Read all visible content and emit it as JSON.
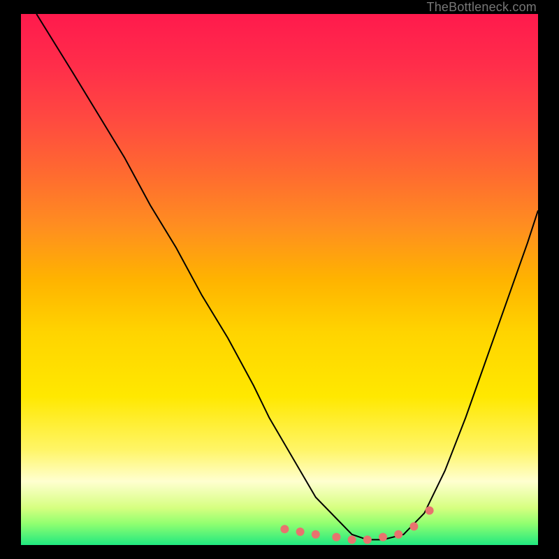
{
  "watermark": {
    "text": "TheBottleneck.com"
  },
  "gradient": {
    "stops": [
      {
        "offset": 0.0,
        "color": "#ff1a4d"
      },
      {
        "offset": 0.1,
        "color": "#ff2e4a"
      },
      {
        "offset": 0.2,
        "color": "#ff4a40"
      },
      {
        "offset": 0.3,
        "color": "#ff6a30"
      },
      {
        "offset": 0.4,
        "color": "#ff8e20"
      },
      {
        "offset": 0.5,
        "color": "#ffb300"
      },
      {
        "offset": 0.6,
        "color": "#ffd400"
      },
      {
        "offset": 0.72,
        "color": "#ffe800"
      },
      {
        "offset": 0.82,
        "color": "#fff566"
      },
      {
        "offset": 0.88,
        "color": "#ffffd0"
      },
      {
        "offset": 0.93,
        "color": "#d6ff80"
      },
      {
        "offset": 0.96,
        "color": "#90ff70"
      },
      {
        "offset": 1.0,
        "color": "#20e880"
      }
    ]
  },
  "marker": {
    "color": "#e8736e",
    "radius_px": 6
  },
  "chart_data": {
    "type": "line",
    "title": "",
    "xlabel": "",
    "ylabel": "",
    "xlim": [
      0,
      100
    ],
    "ylim": [
      0,
      100
    ],
    "grid": false,
    "annotations": [
      "TheBottleneck.com"
    ],
    "series": [
      {
        "name": "bottleneck-curve",
        "x": [
          3,
          10,
          15,
          20,
          25,
          30,
          35,
          40,
          45,
          48,
          51,
          54,
          57,
          61,
          64,
          67,
          70,
          74,
          78,
          82,
          86,
          90,
          94,
          98,
          100
        ],
        "y": [
          100,
          89,
          81,
          73,
          64,
          56,
          47,
          39,
          30,
          24,
          19,
          14,
          9,
          5,
          2,
          1,
          1,
          2,
          6,
          14,
          24,
          35,
          46,
          57,
          63
        ]
      },
      {
        "name": "highlight-markers",
        "x": [
          51,
          54,
          57,
          61,
          64,
          67,
          70,
          73,
          76,
          79
        ],
        "y": [
          3,
          2.5,
          2,
          1.5,
          1,
          1,
          1.5,
          2,
          3.5,
          6.5
        ]
      }
    ]
  }
}
